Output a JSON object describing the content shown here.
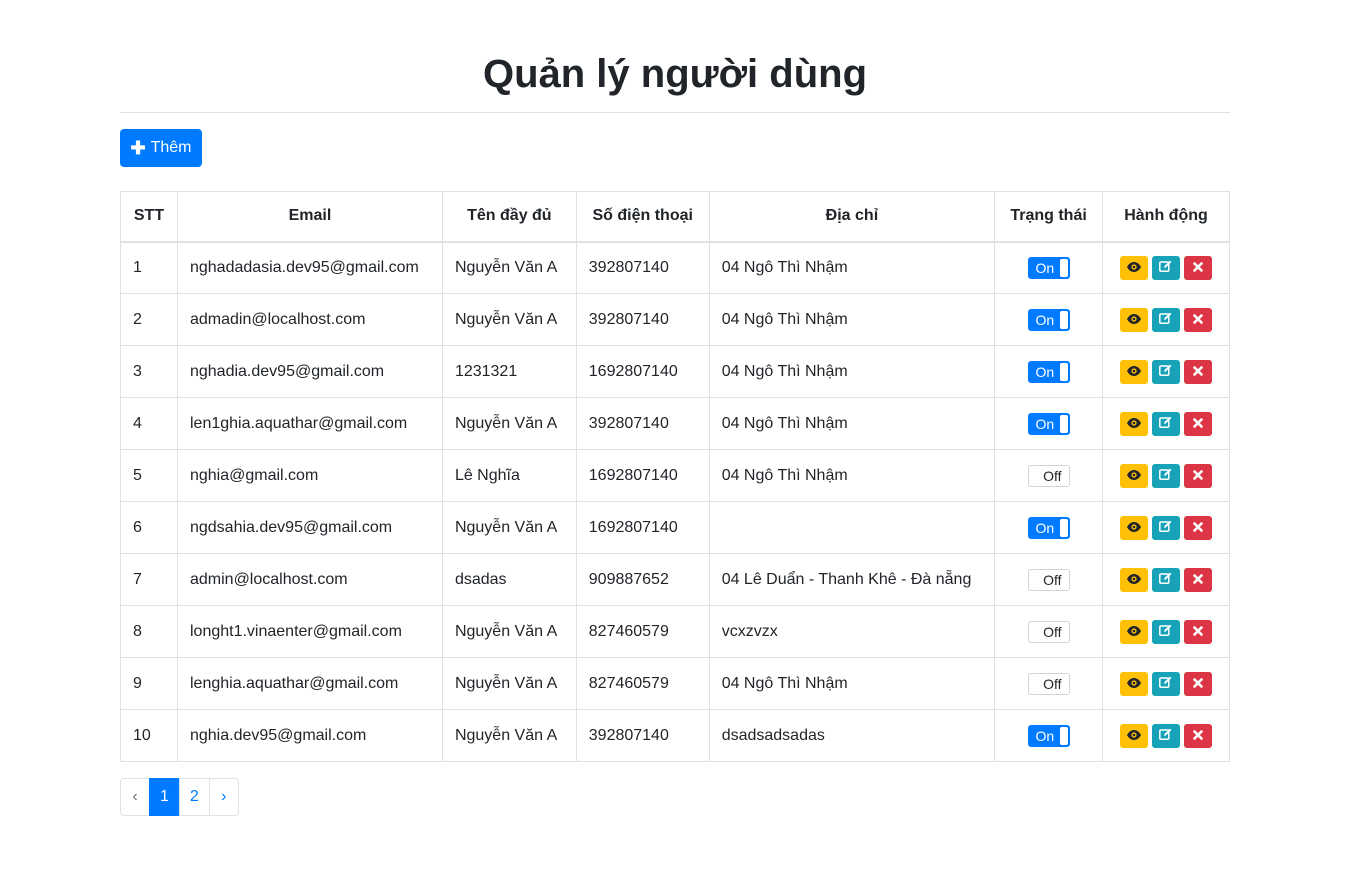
{
  "page": {
    "title": "Quản lý người dùng"
  },
  "toolbar": {
    "add_label": "Thêm",
    "add_icon": "plus-icon"
  },
  "table": {
    "headers": [
      "STT",
      "Email",
      "Tên đầy đủ",
      "Số điện thoại",
      "Địa chỉ",
      "Trạng thái",
      "Hành động"
    ],
    "rows": [
      {
        "stt": "1",
        "email": "nghadadasia.dev95@gmail.com",
        "name": "Nguyễn Văn A",
        "phone": "392807140",
        "address": "04 Ngô Thì Nhậm",
        "status": "On"
      },
      {
        "stt": "2",
        "email": "admadin@localhost.com",
        "name": "Nguyễn Văn A",
        "phone": "392807140",
        "address": "04 Ngô Thì Nhậm",
        "status": "On"
      },
      {
        "stt": "3",
        "email": "nghadia.dev95@gmail.com",
        "name": "1231321",
        "phone": "1692807140",
        "address": "04 Ngô Thì Nhậm",
        "status": "On"
      },
      {
        "stt": "4",
        "email": "len1ghia.aquathar@gmail.com",
        "name": "Nguyễn Văn A",
        "phone": "392807140",
        "address": "04 Ngô Thì Nhậm",
        "status": "On"
      },
      {
        "stt": "5",
        "email": "nghia@gmail.com",
        "name": "Lê Nghĩa",
        "phone": "1692807140",
        "address": "04 Ngô Thì Nhậm",
        "status": "Off"
      },
      {
        "stt": "6",
        "email": "ngdsahia.dev95@gmail.com",
        "name": "Nguyễn Văn A",
        "phone": "1692807140",
        "address": "",
        "status": "On"
      },
      {
        "stt": "7",
        "email": "admin@localhost.com",
        "name": "dsadas",
        "phone": "909887652",
        "address": "04 Lê Duẩn - Thanh Khê - Đà nẵng",
        "status": "Off"
      },
      {
        "stt": "8",
        "email": "longht1.vinaenter@gmail.com",
        "name": "Nguyễn Văn A",
        "phone": "827460579",
        "address": "vcxzvzx",
        "status": "Off"
      },
      {
        "stt": "9",
        "email": "lenghia.aquathar@gmail.com",
        "name": "Nguyễn Văn A",
        "phone": "827460579",
        "address": "04 Ngô Thì Nhậm",
        "status": "Off"
      },
      {
        "stt": "10",
        "email": "nghia.dev95@gmail.com",
        "name": "Nguyễn Văn A",
        "phone": "392807140",
        "address": "dsadsadsadas",
        "status": "On"
      }
    ],
    "action_icons": [
      "eye-icon",
      "edit-icon",
      "close-icon"
    ]
  },
  "colors": {
    "primary": "#007bff",
    "warning": "#ffc107",
    "info": "#17a2b8",
    "danger": "#dc3545",
    "border": "#dee2e6"
  },
  "pagination": {
    "prev": "‹",
    "pages": [
      "1",
      "2"
    ],
    "current": "1",
    "next": "›"
  }
}
